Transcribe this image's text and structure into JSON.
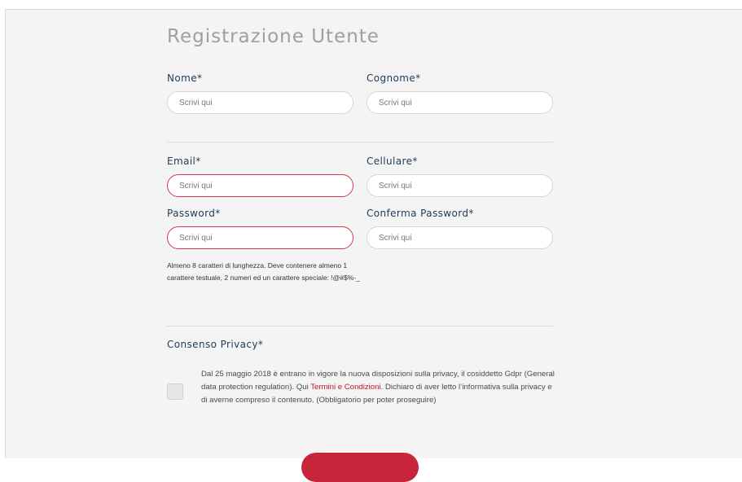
{
  "form": {
    "title": "Registrazione Utente",
    "fields": {
      "nome": {
        "label": "Nome*",
        "placeholder": "Scrivi qui"
      },
      "cognome": {
        "label": "Cognome*",
        "placeholder": "Scrivi qui"
      },
      "email": {
        "label": "Email*",
        "placeholder": "Scrivi qui"
      },
      "cellulare": {
        "label": "Cellulare*",
        "placeholder": "Scrivi qui"
      },
      "password": {
        "label": "Password*",
        "placeholder": "Scrivi qui"
      },
      "conferma_password": {
        "label": "Conferma Password*",
        "placeholder": "Scrivi qui"
      }
    },
    "password_hint": "Almeno 8 caratteri di lunghezza. Deve contenere almeno 1 carattere testuale, 2 numeri ed un carattere speciale: !@#$%-_",
    "privacy": {
      "label": "Consenso Privacy*",
      "text_before": "Dal 25 maggio 2018 è entrano in vigore la nuova disposizioni sulla privacy, il cosiddetto Gdpr (General data protection regulation). Qui ",
      "link_text": "Termini e Condizioni",
      "text_after": ". Dichiaro di aver letto l’informativa sulla privacy e di averne compreso il contenuto. (Obbligatorio per poter proseguire)",
      "checked": false
    },
    "error_color": "#d43a4a",
    "accent_color": "#c8243c",
    "link_color": "#c8102e",
    "label_color": "#1f3b57"
  }
}
